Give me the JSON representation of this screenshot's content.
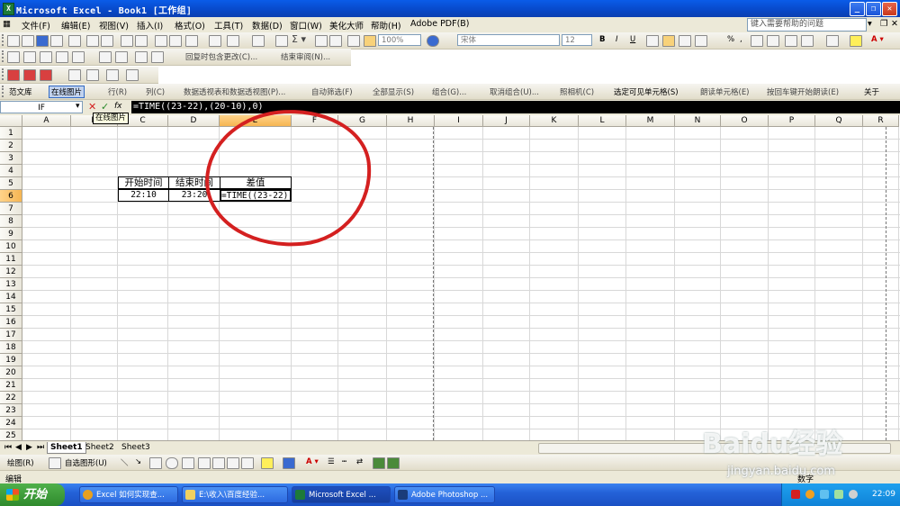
{
  "window": {
    "title": "Microsoft Excel - Book1  [工作组]"
  },
  "menu": {
    "items": [
      "文件(F)",
      "编辑(E)",
      "视图(V)",
      "插入(I)",
      "格式(O)",
      "工具(T)",
      "数据(D)",
      "窗口(W)",
      "美化大师",
      "帮助(H)",
      "Adobe PDF(B)"
    ],
    "help_placeholder": "键入需要帮助的问题"
  },
  "toolbar": {
    "zoom": "100%",
    "font": "宋体",
    "size": "12",
    "reply_review": "回复时包含更改(C)...",
    "end_review": "结束审阅(N)..."
  },
  "addin_toolbar": {
    "items": [
      "范文库",
      "在线图片",
      "行(R)",
      "列(C)",
      "数据透视表和数据透视图(P)...",
      "自动筛选(F)",
      "全部显示(S)",
      "组合(G)...",
      "取消组合(U)...",
      "照相机(C)",
      "选定可见单元格(S)",
      "朗读单元格(E)",
      "按回车键开始朗读(E)",
      "关于"
    ]
  },
  "formula_bar": {
    "name_box": "IF",
    "formula": "=TIME((23-22),(20-10),0)",
    "tooltip": "在线图片"
  },
  "sheet": {
    "columns": [
      "A",
      "B",
      "C",
      "D",
      "E",
      "F",
      "G",
      "H",
      "I",
      "J",
      "K",
      "L",
      "M",
      "N",
      "O",
      "P",
      "Q",
      "R"
    ],
    "rows": [
      "1",
      "2",
      "3",
      "4",
      "5",
      "6",
      "7",
      "8",
      "9",
      "10",
      "11",
      "12",
      "13",
      "14",
      "15",
      "16",
      "17",
      "18",
      "19",
      "20",
      "21",
      "22",
      "23",
      "24",
      "25"
    ],
    "selected_column": "E",
    "selected_row": "6",
    "headers": {
      "start": "开始时间",
      "end": "结束时间",
      "diff": "差值"
    },
    "values": {
      "start": "22:10",
      "end": "23:20",
      "diff": "=TIME((23-22)"
    }
  },
  "tabs": [
    "Sheet1",
    "Sheet2",
    "Sheet3"
  ],
  "drawing_toolbar": {
    "draw": "绘图(R)",
    "autoshapes": "自选图形(U)"
  },
  "status": {
    "mode": "编辑",
    "num": "数字"
  },
  "taskbar": {
    "start": "开始",
    "tasks": [
      "Excel 如何实现查...",
      "E:\\收入\\百度经验...",
      "Microsoft Excel ...",
      "Adobe Photoshop ..."
    ],
    "clock": "22:09"
  },
  "watermark": {
    "logo": "Baidu经验",
    "url": "jingyan.baidu.com"
  },
  "colors": {
    "annotation": "#d42020",
    "titlebar": "#0a5ce8",
    "selection_header": "#f6b552"
  }
}
